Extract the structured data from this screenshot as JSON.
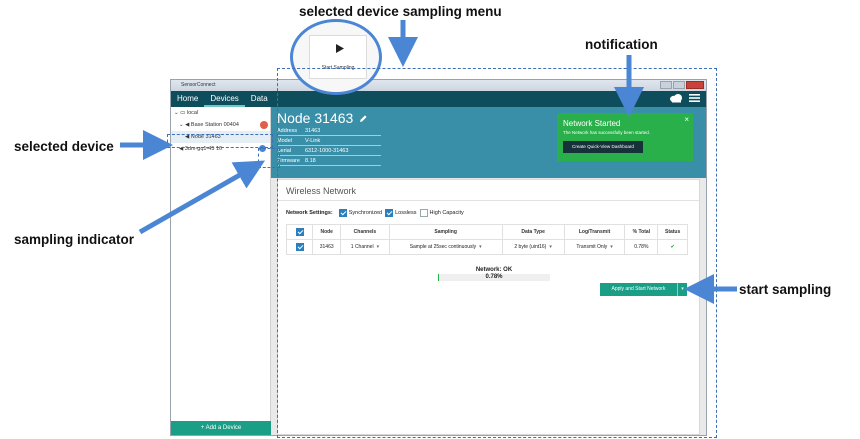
{
  "annotations": {
    "selected_menu": "selected device sampling menu",
    "notification": "notification",
    "selected_device": "selected device",
    "sampling_indicator": "sampling indicator",
    "start_sampling": "start sampling"
  },
  "window": {
    "title": "SensorConnect"
  },
  "nav": {
    "items": [
      "Home",
      "Devices",
      "Data"
    ],
    "active": "Devices"
  },
  "tree": {
    "root": "local",
    "base_station": "Base Station 00404",
    "base_station_badge": "",
    "node_selected": "Node 31463",
    "node_other": "3dm-gq1-45 16"
  },
  "sidebar": {
    "add_device": "+ Add a Device"
  },
  "node": {
    "title": "Node 31463",
    "info": [
      {
        "key": "Address",
        "value": "31463"
      },
      {
        "key": "Model",
        "value": "V-Link"
      },
      {
        "key": "Serial",
        "value": "6312-1000-31463"
      },
      {
        "key": "Firmware",
        "value": "8.18"
      }
    ]
  },
  "notification": {
    "title": "Network Started",
    "message": "The Network has successfully been started.",
    "button": "Create Quick-View Dashboard",
    "close": "×"
  },
  "panel": {
    "title": "Wireless Network",
    "settings_label": "Network Settings:",
    "settings": [
      {
        "label": "Synchronized",
        "checked": true
      },
      {
        "label": "Lossless",
        "checked": true
      },
      {
        "label": "High Capacity",
        "checked": false
      }
    ]
  },
  "table": {
    "headers": [
      "Node",
      "Channels",
      "Sampling",
      "Data Type",
      "Log/Transmit",
      "% Total",
      "Status"
    ],
    "row": {
      "node": "31463",
      "channels": "1 Channel",
      "sampling": "Sample at 25sec continuously",
      "data_type": "2 byte (uint16)",
      "log_transmit": "Transmit Only",
      "total": "0.78%",
      "status": "✔"
    }
  },
  "network_status": {
    "label": "Network: OK",
    "percent_text": "0.78%",
    "percent": 0.78
  },
  "apply_button": {
    "label": "Apply and Start Network",
    "caret": "▾"
  },
  "popup": {
    "label": "Start Sampling"
  },
  "colors": {
    "accent": "#1a9e86",
    "header": "#3a8fa8",
    "navbar": "#0e4d5c",
    "notification": "#2ab04a",
    "annotation": "#4a86d4"
  }
}
